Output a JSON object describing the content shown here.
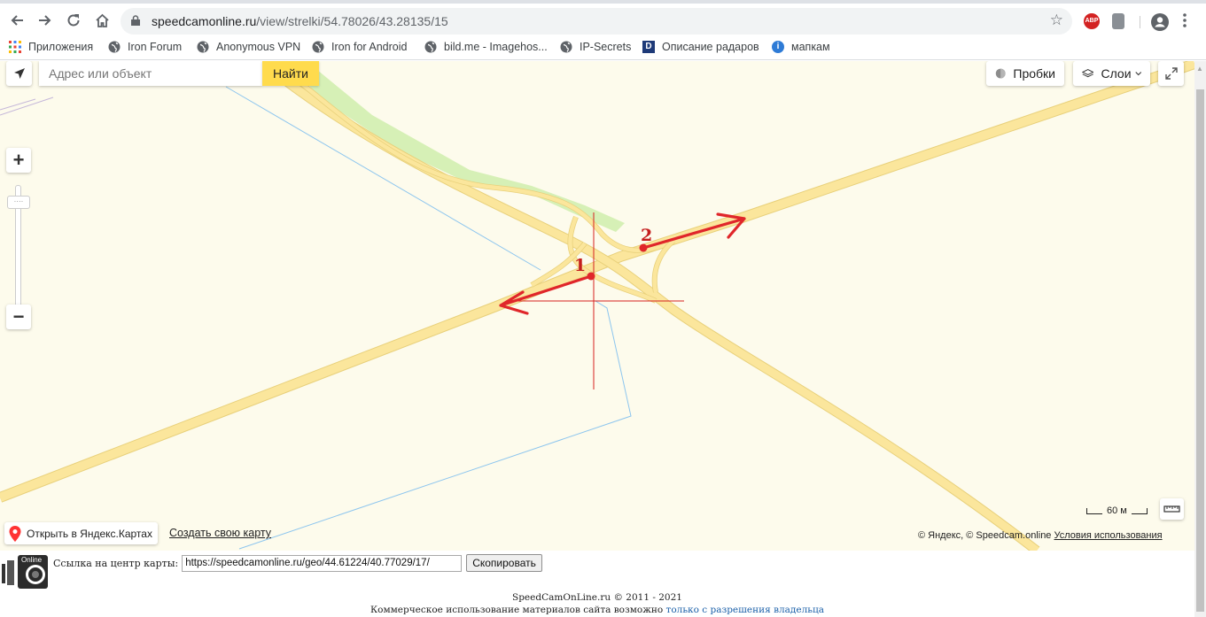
{
  "browser": {
    "url_host": "speedcamonline.ru",
    "url_path": "/view/strelki/54.78026/43.28135/15",
    "extension_abp_label": "ABP"
  },
  "bookmarks": [
    {
      "label": "Приложения",
      "icon": "apps-grid-icon"
    },
    {
      "label": "Iron Forum",
      "icon": "globe-icon"
    },
    {
      "label": "Anonymous VPN",
      "icon": "globe-icon"
    },
    {
      "label": "Iron for Android",
      "icon": "globe-icon"
    },
    {
      "label": "bild.me - Imagehos...",
      "icon": "globe-icon"
    },
    {
      "label": "IP-Secrets",
      "icon": "globe-icon"
    },
    {
      "label": "Описание радаров",
      "icon": "d-icon"
    },
    {
      "label": "мапкам",
      "icon": "info-icon"
    }
  ],
  "map": {
    "search_placeholder": "Адрес или объект",
    "find_label": "Найти",
    "traffic_label": "Пробки",
    "layers_label": "Слои",
    "zoom_in": "+",
    "zoom_out": "−",
    "scale_label": "60 м",
    "open_yandex_label": "Открыть в Яндекс.Картах",
    "create_map_label": "Создать свою карту",
    "copyright": "© Яндекс, © Speedcam.online",
    "terms_label": "Условия использования",
    "marker_1": "1",
    "marker_2": "2",
    "colors": {
      "background": "#fdfbec",
      "road": "#fbe69c",
      "park": "#d6f0b6",
      "water_line": "#8cc5ee",
      "arrow": "#e0262a",
      "crosshair": "#d62020"
    }
  },
  "bottom": {
    "logo_text": "Online",
    "center_link_label": "Ссылка на центр карты:",
    "center_link_value": "https://speedcamonline.ru/geo/44.61224/40.77029/17/",
    "copy_label": "Скопировать",
    "footer_line1": "SpeedCamOnLine.ru © 2011 - 2021",
    "footer_line2_text": "Коммерческое использование материалов сайта возможно",
    "footer_line2_link": "только с разрешения владельца"
  }
}
